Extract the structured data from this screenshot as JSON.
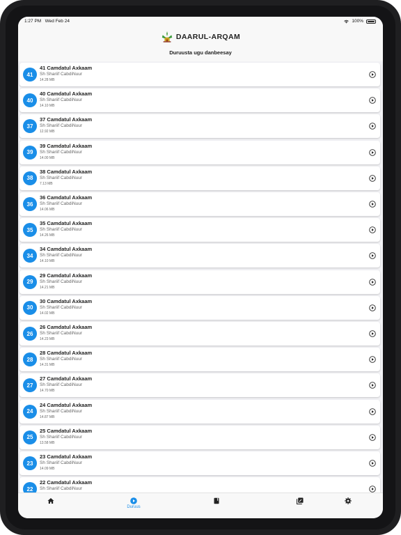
{
  "status": {
    "time": "1:27 PM",
    "date": "Wed Feb 24",
    "battery": "100%"
  },
  "header": {
    "app_title": "DAARUL-ARQAM",
    "subtitle": "Duruusta ugu danbeesay"
  },
  "lessons": [
    {
      "number": "41",
      "title": "41 Camdatul Axkaam",
      "author": "Sh Shariif CabdiNuur",
      "size": "14.28 MB"
    },
    {
      "number": "40",
      "title": "40 Camdatul Axkaam",
      "author": "Sh Shariif CabdiNuur",
      "size": "14.10 MB"
    },
    {
      "number": "37",
      "title": "37 Camdatul Axkaam",
      "author": "Sh Shariif CabdiNuur",
      "size": "12.92 MB"
    },
    {
      "number": "39",
      "title": "39 Camdatul Axkaam",
      "author": "Sh Shariif CabdiNuur",
      "size": "14.00 MB"
    },
    {
      "number": "38",
      "title": "38 Camdatul Axkaam",
      "author": "Sh Shariif CabdiNuur",
      "size": "7.13 MB"
    },
    {
      "number": "36",
      "title": "36 Camdatul Axkaam",
      "author": "Sh Shariif CabdiNuur",
      "size": "14.06 MB"
    },
    {
      "number": "35",
      "title": "35 Camdatul Axkaam",
      "author": "Sh Shariif CabdiNuur",
      "size": "14.26 MB"
    },
    {
      "number": "34",
      "title": "34 Camdatul Axkaam",
      "author": "Sh Shariif CabdiNuur",
      "size": "14.10 MB"
    },
    {
      "number": "29",
      "title": "29 Camdatul Axkaam",
      "author": "Sh Shariif CabdiNuur",
      "size": "14.21 MB"
    },
    {
      "number": "30",
      "title": "30 Camdatul Axkaam",
      "author": "Sh Shariif CabdiNuur",
      "size": "14.02 MB"
    },
    {
      "number": "26",
      "title": "26 Camdatul Axkaam",
      "author": "Sh Shariif CabdiNuur",
      "size": "14.23 MB"
    },
    {
      "number": "28",
      "title": "28 Camdatul Axkaam",
      "author": "Sh Shariif CabdiNuur",
      "size": "14.31 MB"
    },
    {
      "number": "27",
      "title": "27 Camdatul Axkaam",
      "author": "Sh Shariif CabdiNuur",
      "size": "14.70 MB"
    },
    {
      "number": "24",
      "title": "24 Camdatul Axkaam",
      "author": "Sh Shariif CabdiNuur",
      "size": "14.87 MB"
    },
    {
      "number": "25",
      "title": "25 Camdatul Axkaam",
      "author": "Sh Shariif CabdiNuur",
      "size": "13.58 MB"
    },
    {
      "number": "23",
      "title": "23 Camdatul Axkaam",
      "author": "Sh Shariif CabdiNuur",
      "size": "14.09 MB"
    },
    {
      "number": "22",
      "title": "22 Camdatul Axkaam",
      "author": "Sh Shariif CabdiNuur",
      "size": ""
    }
  ],
  "tabbar": {
    "active_label": "Duruus"
  },
  "colors": {
    "accent": "#1a8ee8",
    "background": "#f2f2f5"
  },
  "icons": {
    "tabs": [
      "home-icon",
      "play-circle-icon",
      "book-icon",
      "library-icon",
      "gear-icon"
    ],
    "row_action": "play-circle-outline-icon"
  }
}
